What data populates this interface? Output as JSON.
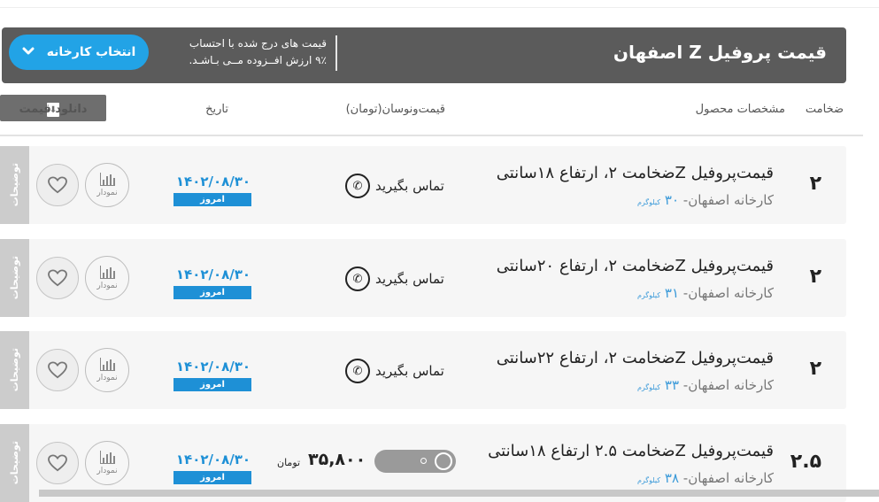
{
  "header": {
    "title": "قیمت پروفیل Z اصفهان",
    "vat_line1": "قیمت های درج شده با احتساب",
    "vat_line2": "۹٪ ارزش افــزوده مــی بـاشـد.",
    "factory_button": "انتخاب کارخانه",
    "chevron_icon": "chevron-down-icon"
  },
  "columns": {
    "thickness": "ضخامت",
    "spec": "مشخصات محصول",
    "price": "قیمت‌ونوسان(تومان)",
    "date": "تاریخ",
    "download": "دانلود قیمت"
  },
  "rows": [
    {
      "thickness": "۲",
      "name": "قیمت‌پروفیل Zضخامت ۲، ارتفاع ۱۸سانتی",
      "factory": "کارخانه اصفهان- ",
      "weight": "۳۰",
      "weight_unit": "کیلوگرم",
      "contact": "تماس بگیرید",
      "date": "۱۴۰۲/۰۸/۳۰",
      "today": "امروز",
      "chart": "نمودار",
      "notes": "توضیحات"
    },
    {
      "thickness": "۲",
      "name": "قیمت‌پروفیل Zضخامت ۲، ارتفاع ۲۰سانتی",
      "factory": "کارخانه اصفهان- ",
      "weight": "۳۱",
      "weight_unit": "کیلوگرم",
      "contact": "تماس بگیرید",
      "date": "۱۴۰۲/۰۸/۳۰",
      "today": "امروز",
      "chart": "نمودار",
      "notes": "توضیحات"
    },
    {
      "thickness": "۲",
      "name": "قیمت‌پروفیل Zضخامت ۲، ارتفاع ۲۲سانتی",
      "factory": "کارخانه اصفهان- ",
      "weight": "۳۳",
      "weight_unit": "کیلوگرم",
      "contact": "تماس بگیرید",
      "date": "۱۴۰۲/۰۸/۳۰",
      "today": "امروز",
      "chart": "نمودار",
      "notes": "توضیحات"
    },
    {
      "thickness": "۲.۵",
      "name": "قیمت‌پروفیل Zضخامت ۲.۵ ارتفاع ۱۸سانتی",
      "factory": "کارخانه اصفهان- ",
      "weight": "۳۸",
      "weight_unit": "کیلوگرم",
      "price": "۳۵,۸۰۰",
      "currency": "تومان",
      "date": "۱۴۰۲/۰۸/۳۰",
      "today": "امروز",
      "chart": "نمودار",
      "notes": "توضیحات"
    }
  ],
  "colors": {
    "header_bg": "#5b5b5b",
    "accent_blue": "#22a3e6",
    "date_blue": "#1e90d6",
    "row_bg": "#f6f6f6"
  }
}
